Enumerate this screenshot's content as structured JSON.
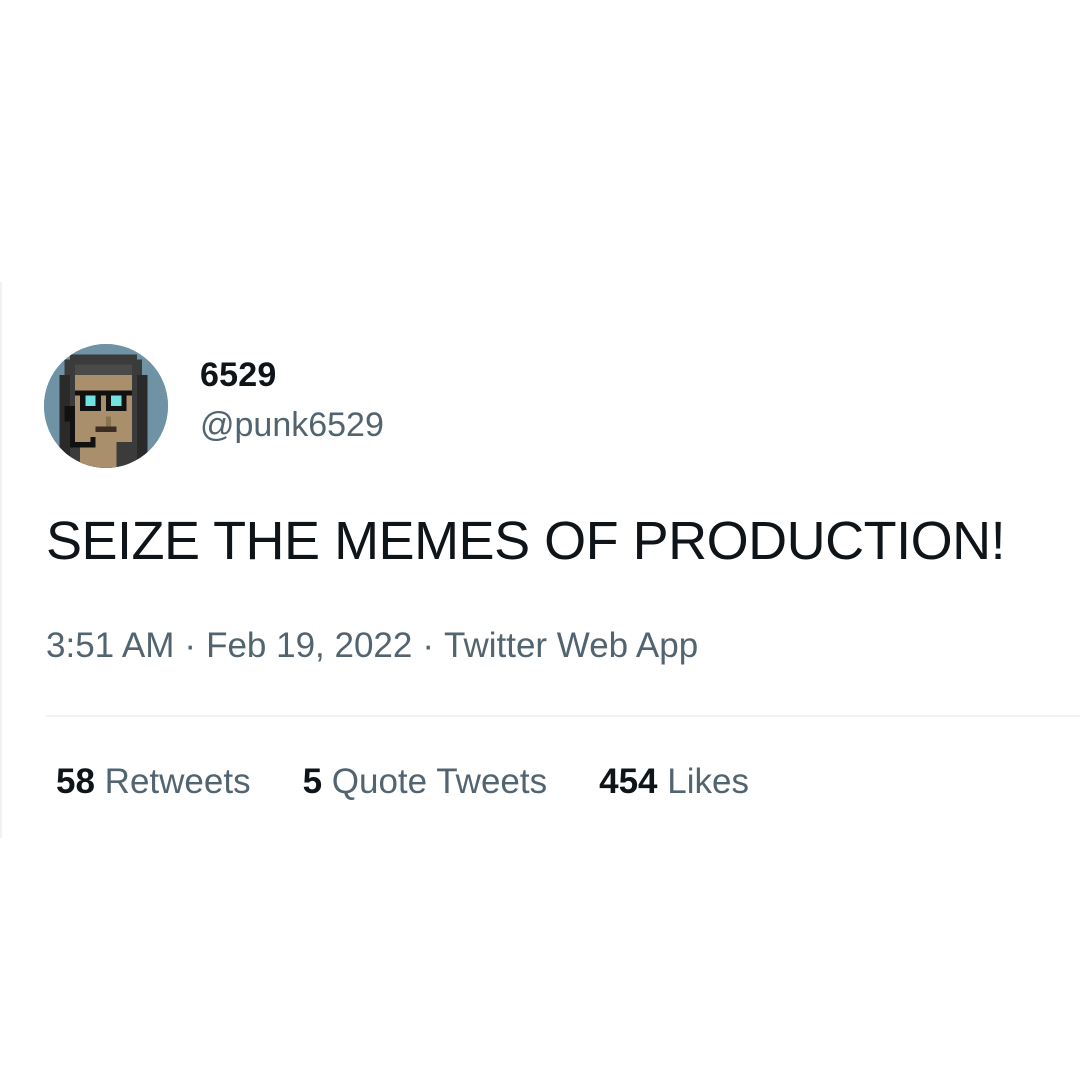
{
  "tweet": {
    "display_name": "6529",
    "handle": "@punk6529",
    "text": "SEIZE THE MEMES OF PRODUCTION!",
    "time": "3:51 AM",
    "date": "Feb 19, 2022",
    "separator": "·",
    "source": "Twitter Web App",
    "avatar_icon": "cryptopunk-avatar-icon"
  },
  "stats": {
    "retweets_count": "58",
    "retweets_label": "Retweets",
    "quote_tweets_count": "5",
    "quote_tweets_label": "Quote Tweets",
    "likes_count": "454",
    "likes_label": "Likes"
  },
  "colors": {
    "text_primary": "#0f1419",
    "text_secondary": "#536471",
    "divider": "#eff3f4",
    "avatar_background": "#6f93a5"
  }
}
